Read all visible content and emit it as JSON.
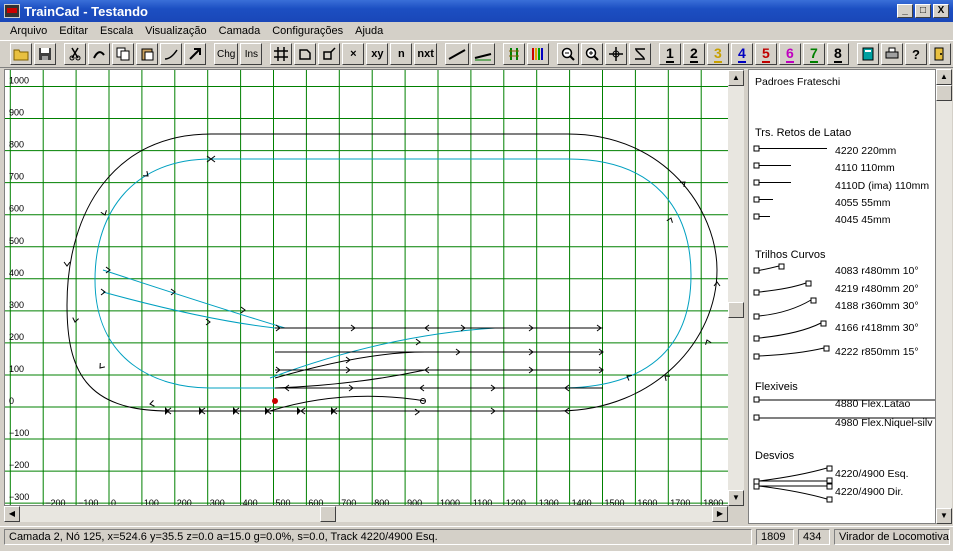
{
  "window": {
    "title": "TrainCad - Testando",
    "minimize": "_",
    "maximize": "□",
    "close": "X"
  },
  "menu": [
    "Arquivo",
    "Editar",
    "Escala",
    "Visualização",
    "Camada",
    "Configurações",
    "Ajuda"
  ],
  "toolbar": {
    "chg_label": "Chg",
    "ins_label": "Ins",
    "x_label": "×",
    "xy_label": "xy",
    "n_label": "n",
    "nxt_label": "nxt",
    "layers": [
      "1",
      "2",
      "3",
      "4",
      "5",
      "6",
      "7",
      "8"
    ],
    "layer_colors": [
      "#000000",
      "#000000",
      "#c8a000",
      "#0000c0",
      "#c00000",
      "#c000c0",
      "#008000",
      "#000000"
    ]
  },
  "canvas": {
    "y_ticks": [
      "1000",
      "900",
      "800",
      "700",
      "600",
      "500",
      "400",
      "300",
      "200",
      "100",
      "0",
      "−100",
      "−200",
      "−300"
    ],
    "x_ticks": [
      "−200",
      "−100",
      "0",
      "100",
      "200",
      "300",
      "400",
      "500",
      "600",
      "700",
      "800",
      "900",
      "1000",
      "1100",
      "1200",
      "1300",
      "1400",
      "1500",
      "1600",
      "1700",
      "1800"
    ],
    "grid_color": "#008000",
    "track_colors": {
      "outer": "#000000",
      "inner": "#00a0c0"
    }
  },
  "panel": {
    "title": "Padroes Frateschi",
    "sections": [
      {
        "heading": "Trs. Retos de Latao",
        "items": [
          "4220 220mm",
          "4110 110mm",
          "4110D (ima) 110mm",
          "4055 55mm",
          "4045 45mm"
        ]
      },
      {
        "heading": "Trilhos Curvos",
        "items": [
          "4083 r480mm 10°",
          "4219 r480mm 20°",
          "4188 r360mm 30°",
          "4166 r418mm 30°",
          "4222 r850mm 15°"
        ]
      },
      {
        "heading": "Flexiveis",
        "items": [
          "4880 Flex.Latao",
          "4980 Flex.Niquel-silv"
        ]
      },
      {
        "heading": "Desvios",
        "items": [
          "4220/4900 Esq.",
          "4220/4900 Dir."
        ]
      }
    ]
  },
  "status": {
    "main": "Camada 2, Nó 125, x=524.6 y=35.5 z=0.0 a=15.0 g=0.0%, s=0.0, Track 4220/4900 Esq.",
    "coord_x": "1809",
    "coord_y": "434",
    "mode": "Virador de Locomotivas"
  }
}
